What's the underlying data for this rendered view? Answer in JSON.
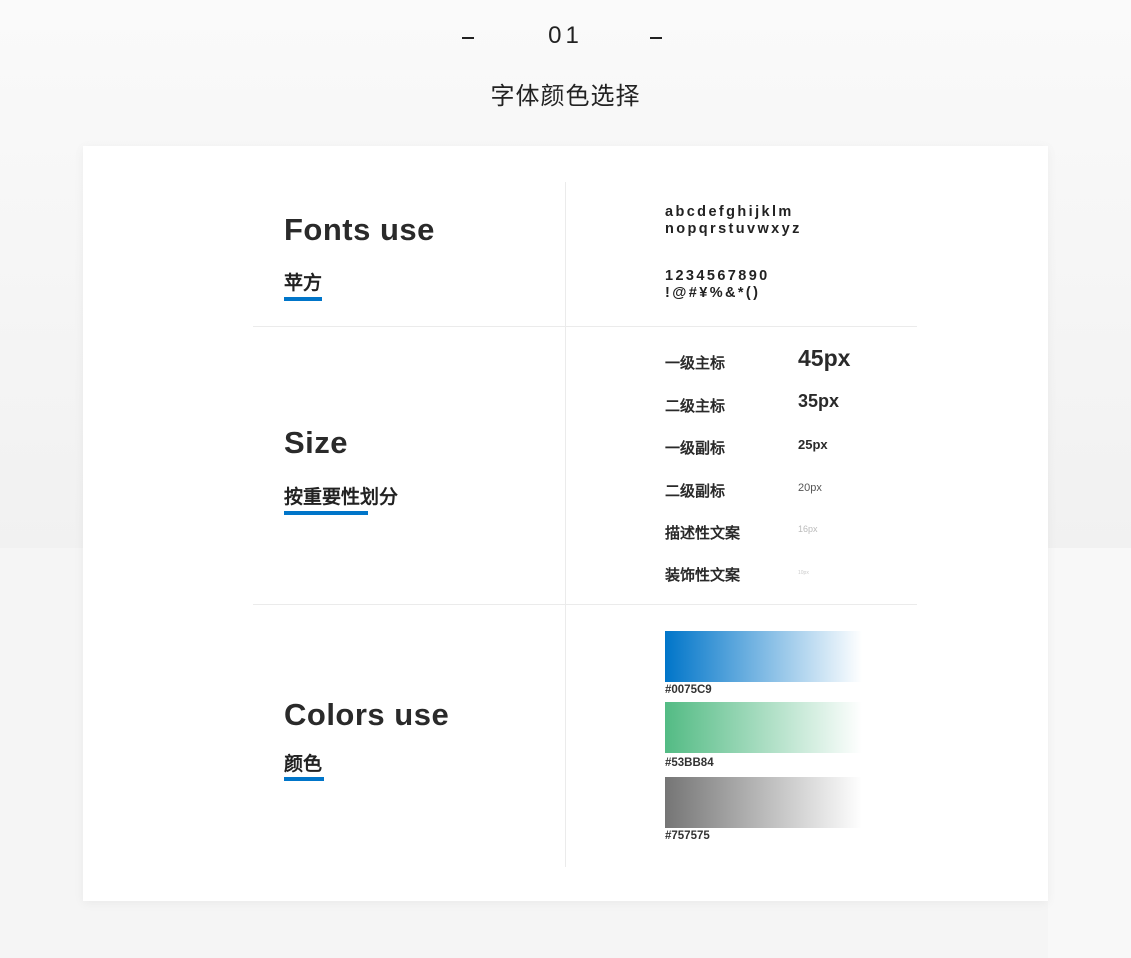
{
  "header": {
    "number": "01",
    "title": "字体颜色选择"
  },
  "fonts": {
    "title": "Fonts use",
    "subtitle": "苹方",
    "lowercase_1": "abcdefghijklm",
    "lowercase_2": "nopqrstuvwxyz",
    "digits": "1234567890",
    "symbols": "!@#¥%&*()"
  },
  "size": {
    "title": "Size",
    "subtitle": "按重要性划分",
    "rows": [
      {
        "label": "一级主标",
        "value": "45px",
        "color": "#2a2a2a"
      },
      {
        "label": "二级主标",
        "value": "35px",
        "color": "#2a2a2a"
      },
      {
        "label": "一级副标",
        "value": "25px",
        "color": "#2a2a2a"
      },
      {
        "label": "二级副标",
        "value": "20px",
        "color": "#555555"
      },
      {
        "label": "描述性文案",
        "value": "16px",
        "color": "#bbbbbb"
      },
      {
        "label": "装饰性文案",
        "value": "10px",
        "color": "#cccccc"
      }
    ]
  },
  "colors": {
    "title": "Colors use",
    "subtitle": "颜色",
    "swatches": [
      {
        "label": "#0075C9",
        "hex": "#0075C9"
      },
      {
        "label": "#53BB84",
        "hex": "#53BB84"
      },
      {
        "label": "#757575",
        "hex": "#757575"
      }
    ]
  },
  "accent_color": "#0075C9"
}
